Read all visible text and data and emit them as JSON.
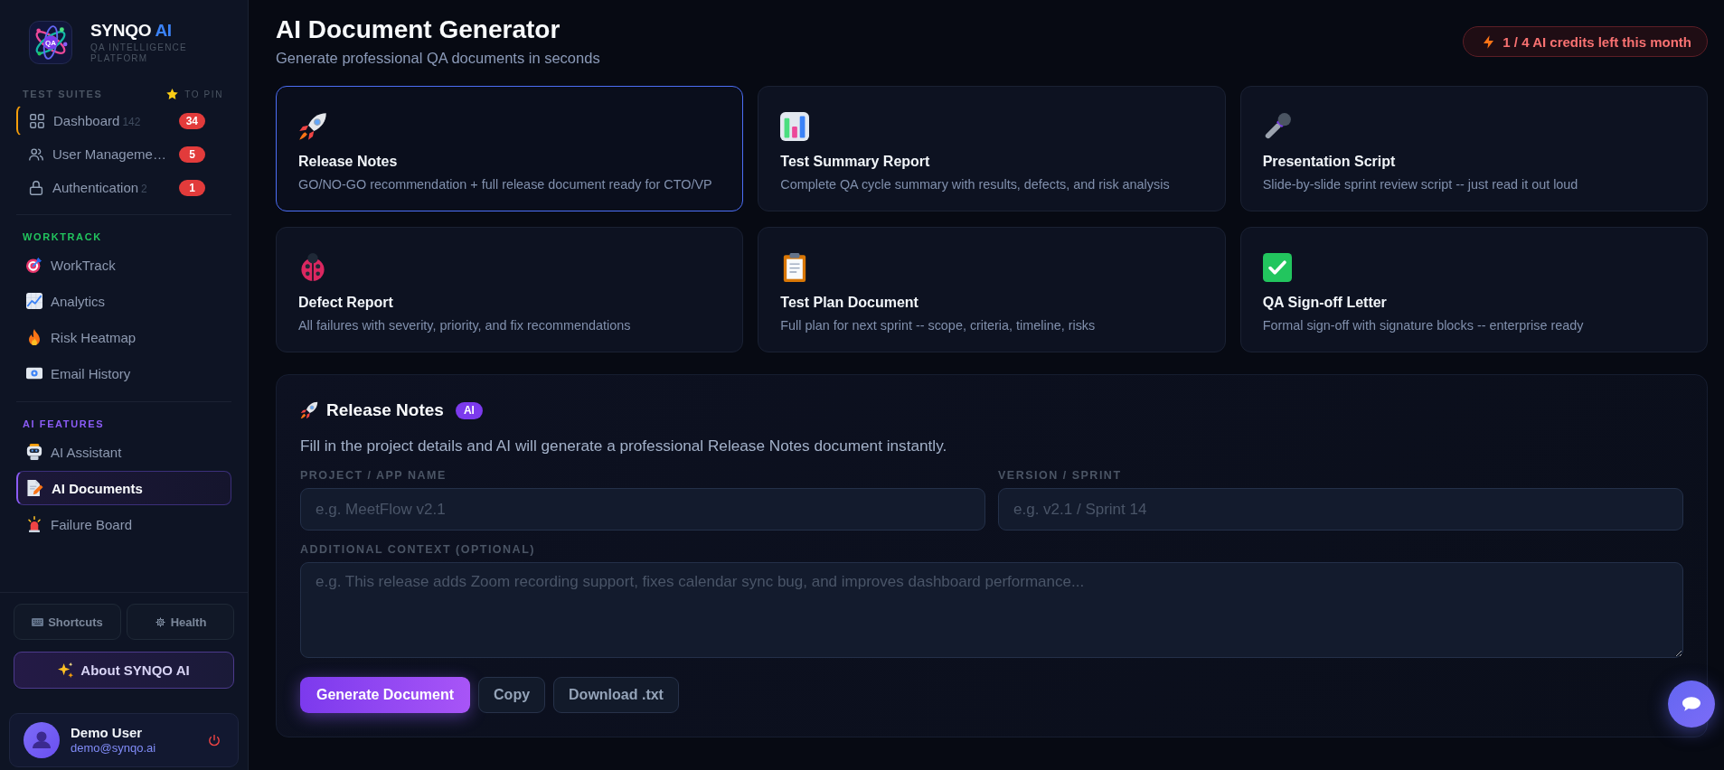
{
  "sidebar": {
    "brand": {
      "logo_text": "QA",
      "name": "SYNQO",
      "name_accent": "AI",
      "tagline": "QA INTELLIGENCE PLATFORM"
    },
    "sections": [
      {
        "title": "TEST SUITES",
        "color": "#4b5563",
        "kind": "suites",
        "pin_hint": "TO PIN",
        "items": [
          {
            "label": "Dashboard",
            "count": "142",
            "badge": "34",
            "highlighted": true,
            "selected": false
          },
          {
            "label": "User Manageme…",
            "badge": "5",
            "highlighted": false,
            "selected": false
          },
          {
            "label": "Authentication",
            "count": "2",
            "badge": "1",
            "highlighted": false,
            "selected": false
          }
        ]
      },
      {
        "title": "WORKTRACK",
        "color": "#22c55e",
        "kind": "links",
        "items": [
          {
            "label": "WorkTrack",
            "selected": false
          },
          {
            "label": "Analytics",
            "selected": false
          },
          {
            "label": "Risk Heatmap",
            "selected": false
          },
          {
            "label": "Email History",
            "selected": false
          }
        ]
      },
      {
        "title": "AI FEATURES",
        "color": "#8b5cf6",
        "kind": "links",
        "items": [
          {
            "label": "AI Assistant",
            "selected": false
          },
          {
            "label": "AI Documents",
            "selected": true
          },
          {
            "label": "Failure Board",
            "selected": false
          }
        ]
      }
    ],
    "footer_buttons": [
      "Shortcuts",
      "Health"
    ],
    "about_button": "About SYNQO AI",
    "user": {
      "name": "Demo User",
      "email": "demo@synqo.ai"
    }
  },
  "header": {
    "title": "AI Document Generator",
    "subtitle": "Generate professional QA documents in seconds",
    "credits": "1 / 4 AI credits left this month"
  },
  "doc_types": [
    {
      "title": "Release Notes",
      "description": "GO/NO-GO recommendation + full release document ready for CTO/VP",
      "selected": true
    },
    {
      "title": "Test Summary Report",
      "description": "Complete QA cycle summary with results, defects, and risk analysis",
      "selected": false
    },
    {
      "title": "Presentation Script",
      "description": "Slide-by-slide sprint review script -- just read it out loud",
      "selected": false
    },
    {
      "title": "Defect Report",
      "description": "All failures with severity, priority, and fix recommendations",
      "selected": false
    },
    {
      "title": "Test Plan Document",
      "description": "Full plan for next sprint -- scope, criteria, timeline, risks",
      "selected": false
    },
    {
      "title": "QA Sign-off Letter",
      "description": "Formal sign-off with signature blocks -- enterprise ready",
      "selected": false
    }
  ],
  "form": {
    "title": "Release Notes",
    "badge": "AI",
    "description": "Fill in the project details and AI will generate a professional Release Notes document instantly.",
    "fields": [
      {
        "kind": "input",
        "label": "PROJECT / APP NAME",
        "placeholder": "e.g. MeetFlow v2.1"
      },
      {
        "kind": "input",
        "label": "VERSION / SPRINT",
        "placeholder": "e.g. v2.1 / Sprint 14"
      },
      {
        "kind": "textarea",
        "label": "ADDITIONAL CONTEXT (OPTIONAL)",
        "placeholder": "e.g. This release adds Zoom recording support, fixes calendar sync bug, and improves dashboard performance..."
      }
    ],
    "buttons": [
      {
        "kind": "primary",
        "label": "Generate Document"
      },
      {
        "kind": "secondary",
        "label": "Copy"
      },
      {
        "kind": "secondary",
        "label": "Download .txt"
      }
    ]
  }
}
